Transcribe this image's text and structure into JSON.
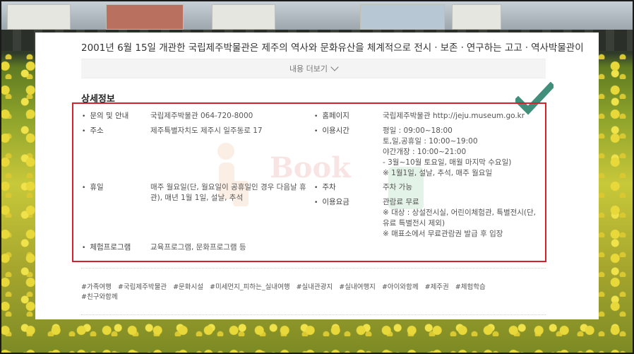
{
  "intro_text": "2001년 6월 15일 개관한 국립제주박물관은 제주의 역사와 문화유산을 체계적으로 전시ㆍ보존ㆍ연구하는 고고ㆍ역사박물관이",
  "more_label": "내용 더보기",
  "section_title": "상세정보",
  "watermark_text": "Book",
  "details_left": [
    {
      "label": "문의 및 안내",
      "value": [
        "국립제주박물관 064-720-8000"
      ]
    },
    {
      "label": "주소",
      "value": [
        "제주특별자치도 제주시 일주동로 17"
      ]
    },
    {
      "label": "휴일",
      "value": [
        "매주 월요일(단, 월요일이 공휴일인 경우 다음날 휴",
        "관), 매년 1월 1일, 설날, 추석"
      ]
    },
    {
      "label": "체험프로그램",
      "value": [
        "교육프로그램, 문화프로그램 등"
      ]
    }
  ],
  "details_right": [
    {
      "label": "홈페이지",
      "value": [
        "국립제주박물관 http://jeju.museum.go.kr"
      ]
    },
    {
      "label": "이용시간",
      "value": [
        "평일 : 09:00~18:00",
        "토,일,공휴일 : 10:00~19:00",
        "야간개장 : 10:00~21:00",
        "- 3월~10월 토요일, 매월 마지막 수요일)",
        "※ 1월1일, 설날, 추석, 매주 월요일"
      ]
    },
    {
      "label": "주차",
      "value": [
        "주차 가능"
      ]
    },
    {
      "label": "이용요금",
      "value": [
        "관람료 무료",
        "※ 대상 : 상설전시실, 어린이체험관, 특별전시(단,",
        "유료 특별전시 제외)",
        "※ 매표소에서 무료관람권 발급 후 입장"
      ]
    }
  ],
  "tags": [
    "#가족여행",
    "#국립제주박물관",
    "#문화시설",
    "#미세먼지_피하는_실내여행",
    "#실내관광지",
    "#실내여행지",
    "#아이와함께",
    "#제주권",
    "#체험학습",
    "#친구와함께"
  ],
  "colors": {
    "highlight_box": "#d6212a",
    "checkmark": "#3f8f7a"
  }
}
